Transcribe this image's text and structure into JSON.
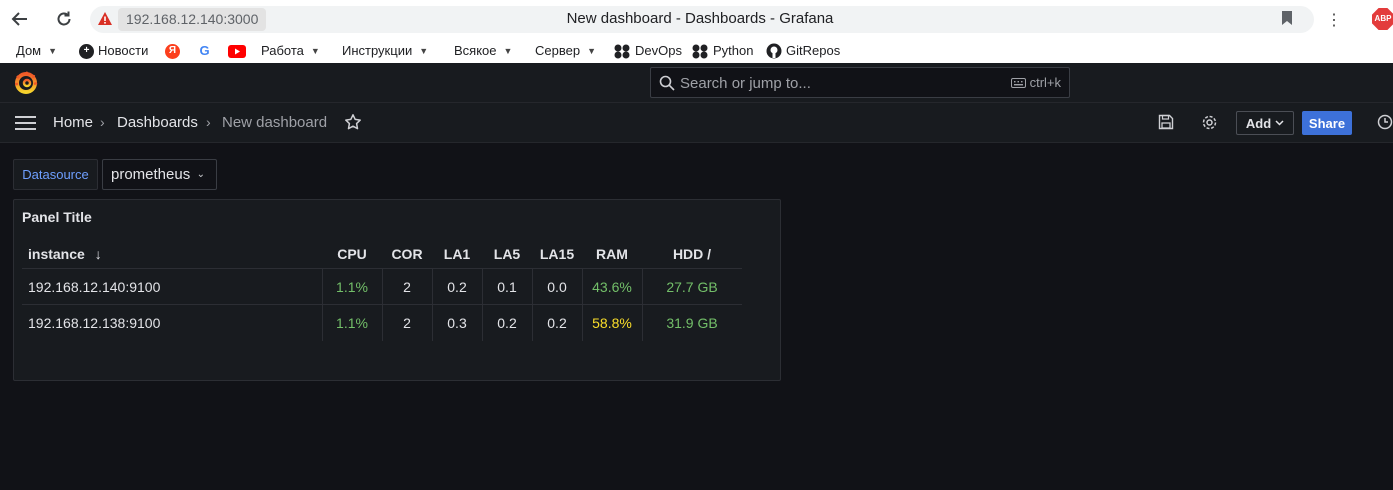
{
  "browser": {
    "url": "192.168.12.140:3000",
    "tab_title": "New dashboard - Dashboards - Grafana",
    "abp_label": "ABP",
    "bookmarks": [
      {
        "label": "Дом",
        "has_menu": true
      },
      {
        "label": "Новости",
        "has_menu": false
      },
      {
        "label": "Я",
        "has_menu": false
      },
      {
        "label": "G",
        "has_menu": false
      },
      {
        "label": "",
        "has_menu": false
      },
      {
        "label": "Работа",
        "has_menu": true
      },
      {
        "label": "Инструкции",
        "has_menu": true
      },
      {
        "label": "Всякое",
        "has_menu": true
      },
      {
        "label": "Сервер",
        "has_menu": true
      },
      {
        "label": "DevOps",
        "has_menu": false
      },
      {
        "label": "Python",
        "has_menu": false
      },
      {
        "label": "GitRepos",
        "has_menu": false
      }
    ]
  },
  "grafana": {
    "search_placeholder": "Search or jump to...",
    "search_shortcut": "ctrl+k",
    "breadcrumbs": [
      "Home",
      "Dashboards",
      "New dashboard"
    ],
    "add_label": "Add",
    "share_label": "Share",
    "variable": {
      "label": "Datasource",
      "value": "prometheus"
    },
    "panel": {
      "title": "Panel Title",
      "columns": [
        "instance",
        "CPU",
        "COR",
        "LA1",
        "LA5",
        "LA15",
        "RAM",
        "HDD /"
      ],
      "sort_column": "instance",
      "rows": [
        {
          "instance": "192.168.12.140:9100",
          "cpu": "1.1%",
          "cor": "2",
          "la1": "0.2",
          "la5": "0.1",
          "la15": "0.0",
          "ram": "43.6%",
          "hdd": "27.7 GB",
          "cpu_color": "#73bf69",
          "ram_color": "#73bf69",
          "hdd_color": "#73bf69"
        },
        {
          "instance": "192.168.12.138:9100",
          "cpu": "1.1%",
          "cor": "2",
          "la1": "0.3",
          "la5": "0.2",
          "la15": "0.2",
          "ram": "58.8%",
          "hdd": "31.9 GB",
          "cpu_color": "#73bf69",
          "ram_color": "#fade2a",
          "hdd_color": "#73bf69"
        }
      ]
    }
  },
  "colors": {
    "accent": "#3d71d9",
    "ok": "#73bf69",
    "warn": "#fade2a"
  }
}
